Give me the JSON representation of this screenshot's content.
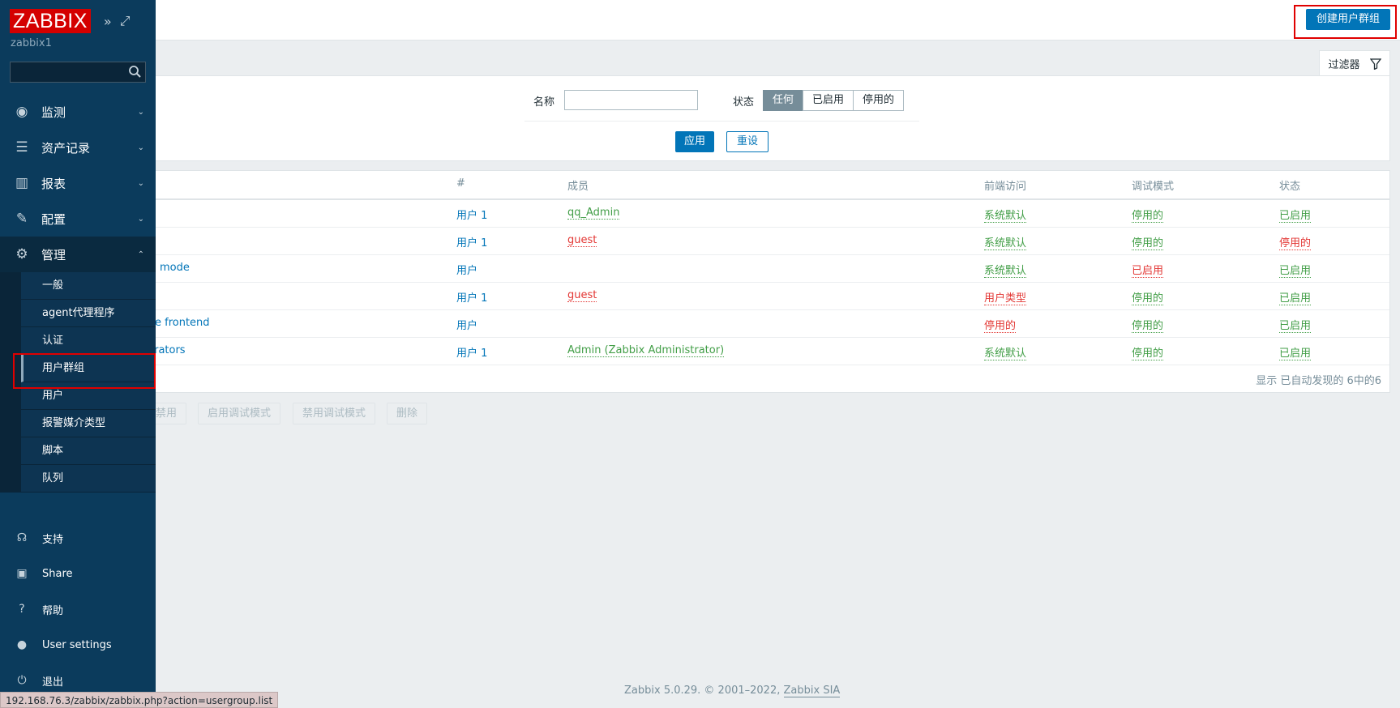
{
  "app": {
    "logo": "ZABBIX",
    "server_name": "zabbix1"
  },
  "sidebar": {
    "search_placeholder": "",
    "menu": [
      {
        "label": "监测",
        "icon": "eye-icon"
      },
      {
        "label": "资产记录",
        "icon": "list-icon"
      },
      {
        "label": "报表",
        "icon": "bar-chart-icon"
      },
      {
        "label": "配置",
        "icon": "wrench-icon"
      },
      {
        "label": "管理",
        "icon": "gear-icon"
      }
    ],
    "admin_submenu": [
      "一般",
      "agent代理程序",
      "认证",
      "用户群组",
      "用户",
      "报警媒介类型",
      "脚本",
      "队列"
    ],
    "bottom": [
      {
        "label": "支持",
        "icon": "headset-icon"
      },
      {
        "label": "Share",
        "icon": "share-icon"
      },
      {
        "label": "帮助",
        "icon": "help-icon"
      },
      {
        "label": "User settings",
        "icon": "user-icon"
      },
      {
        "label": "退出",
        "icon": "power-icon"
      }
    ]
  },
  "header": {
    "create_button": "创建用户群组"
  },
  "filter": {
    "tab_label": "过滤器",
    "name_label": "名称",
    "name_value": "",
    "status_label": "状态",
    "status_options": [
      "任何",
      "已启用",
      "停用的"
    ],
    "status_selected": "任何",
    "apply": "应用",
    "reset": "重设"
  },
  "table": {
    "headers": {
      "count": "#",
      "members": "成员",
      "frontend": "前端访问",
      "debug": "调试模式",
      "status": "状态"
    },
    "rows": [
      {
        "name": "",
        "count": "用户 1",
        "members": "qq_Admin",
        "frontend": "系统默认",
        "debug": "停用的",
        "status": "已启用"
      },
      {
        "name": "",
        "count": "用户 1",
        "members": "guest",
        "frontend": "系统默认",
        "debug": "停用的",
        "status": "停用的"
      },
      {
        "name": "mode",
        "count": "用户",
        "members": "",
        "frontend": "系统默认",
        "debug": "已启用",
        "status": "已启用"
      },
      {
        "name": "",
        "count": "用户 1",
        "members": "guest",
        "frontend": "用户类型",
        "debug": "停用的",
        "status": "已启用"
      },
      {
        "name": "e frontend",
        "count": "用户",
        "members": "",
        "frontend": "停用的",
        "debug": "停用的",
        "status": "已启用"
      },
      {
        "name": "trators",
        "count": "用户 1",
        "members": "Admin (Zabbix Administrator)",
        "frontend": "系统默认",
        "debug": "停用的",
        "status": "已启用"
      }
    ],
    "footer": "显示 已自动发现的 6中的6"
  },
  "mass_actions": [
    "禁用",
    "启用调试模式",
    "禁用调试模式",
    "删除"
  ],
  "footer": {
    "copyright_prefix": "Zabbix 5.0.29. © 2001–2022,",
    "company": "Zabbix SIA"
  },
  "status_url": "192.168.76.3/zabbix/zabbix.php?action=usergroup.list",
  "colors": {
    "sidebar": "#0b3b5c",
    "accent": "#0275b8",
    "green": "#429e47",
    "red": "#e33734"
  }
}
